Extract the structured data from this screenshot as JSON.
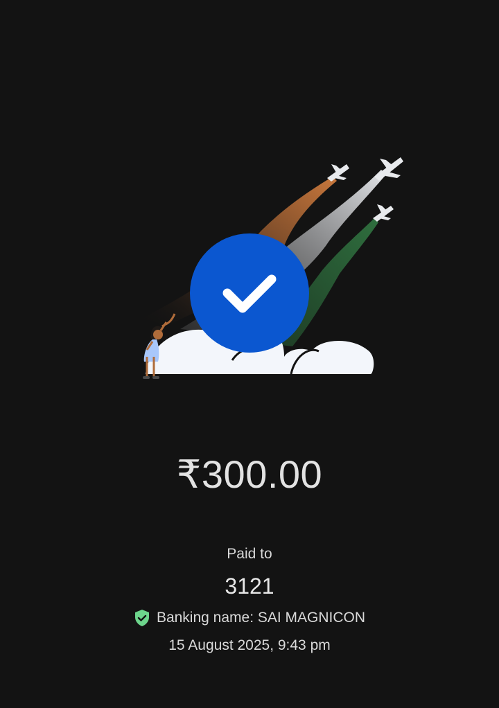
{
  "payment": {
    "amount": "₹300.00",
    "paid_to_label": "Paid to",
    "payee": "3121",
    "banking_name_label": "Banking name: SAI MAGNICON",
    "datetime": "15 August 2025, 9:43 pm"
  },
  "icons": {
    "success": "check-icon",
    "verified": "shield-check-icon"
  },
  "colors": {
    "background": "#131313",
    "success_circle": "#0b57d0",
    "saffron": "#c8773c",
    "white_trail": "#dfe1e5",
    "green": "#2e6b3c",
    "cloud": "#f3f6fb",
    "verified_green": "#6dd58c"
  }
}
